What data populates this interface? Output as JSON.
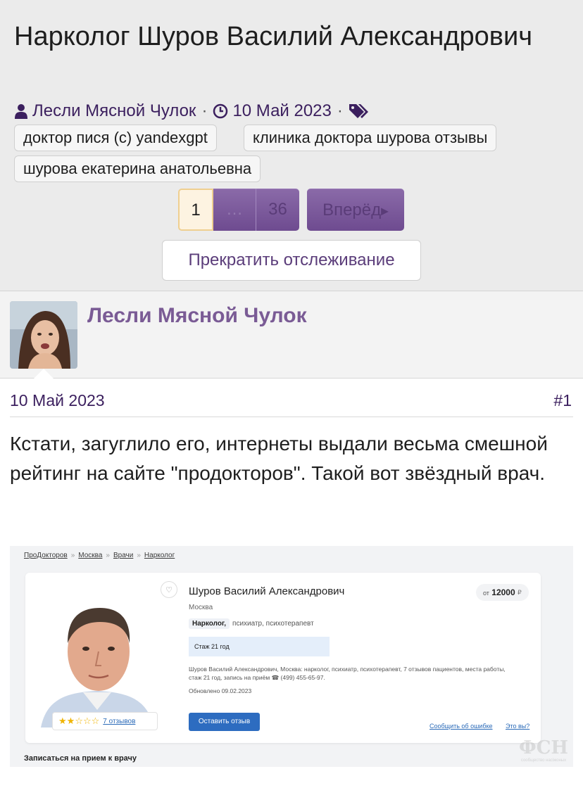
{
  "thread": {
    "title": "Нарколог Шуров Василий Александрович",
    "author": "Лесли Мясной Чулок",
    "date": "10 Май 2023",
    "tags": [
      "доктор пися (с) yandexgpt",
      "клиника доктора шурова отзывы",
      "шурова екатерина анатольевна"
    ]
  },
  "pagination": {
    "current": "1",
    "ellipsis": "…",
    "last": "36",
    "next_label": "Вперёд"
  },
  "unwatch_label": "Прекратить отслеживание",
  "post": {
    "author": "Лесли Мясной Чулок",
    "date": "10 Май 2023",
    "number": "#1",
    "text": "Кстати, загуглило его, интернеты выдали весьма смешной рейтинг на сайте \"продокторов\". Такой вот звёздный врач."
  },
  "embed": {
    "breadcrumbs": [
      "ПроДокторов",
      "Москва",
      "Врачи",
      "Нарколог"
    ],
    "doctor_name": "Шуров Василий Александрович",
    "city": "Москва",
    "specialty_main": "Нарколог,",
    "specialties_other": "психиатр,  психотерапевт",
    "experience": "Стаж 21 год",
    "description": "Шуров Василий Александрович, Москва: нарколог, психиатр, психотерапевт, 7 отзывов пациентов, места работы, стаж 21 год, запись на приём ☎ (499) 455-65-97.",
    "updated": "Обновлено 09.02.2023",
    "price_prefix": "от",
    "price": "12000",
    "currency": "₽",
    "rating_stars": 2,
    "rating_max": 5,
    "reviews_link": "7 отзывов",
    "review_button": "Оставить отзыв",
    "report_error": "Сообщить об ошибке",
    "who_are_you": "Это вы?",
    "appointment_heading": "Записаться на прием к врачу",
    "watermark": "ФСН",
    "watermark_sub": "сообщество насіжоных"
  },
  "colors": {
    "accent_purple": "#7a5b95",
    "link_dark": "#3b1f5e",
    "pager_purple": "#6e4b90",
    "current_page_bg": "#fdf3e1",
    "embed_blue": "#2d6cc0",
    "star_gold": "#f0b400"
  }
}
